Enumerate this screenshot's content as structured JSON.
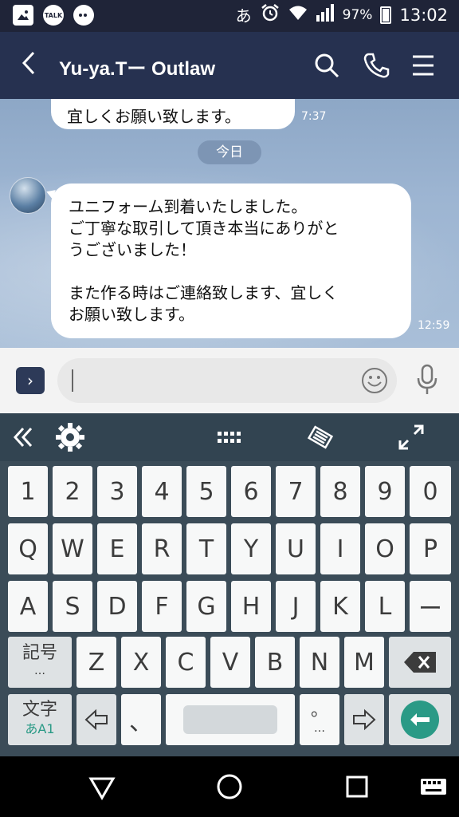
{
  "status_bar": {
    "notification_icons": [
      "image-icon",
      "talk-icon",
      "chat-bubble-icon"
    ],
    "talk_label": "TALK",
    "input_mode": "あ",
    "battery": "97%",
    "time": "13:02"
  },
  "header": {
    "title": "Yu-ya.Tー Outlaw"
  },
  "chat": {
    "previous_message": "宜しくお願い致します。",
    "previous_time": "7:37",
    "date_divider": "今日",
    "message_lines_1": [
      "ユニフォーム到着いたしました。",
      "ご丁寧な取引して頂き本当にありがと",
      "うございました！"
    ],
    "message_lines_2": [
      "また作る時はご連絡致します、宜しく",
      "お願い致します。"
    ],
    "message_time": "12:59"
  },
  "input": {
    "expand_label": "›",
    "placeholder": ""
  },
  "keyboard": {
    "row_numbers": [
      "1",
      "2",
      "3",
      "4",
      "5",
      "6",
      "7",
      "8",
      "9",
      "0"
    ],
    "row_top": [
      "Q",
      "W",
      "E",
      "R",
      "T",
      "Y",
      "U",
      "I",
      "O",
      "P"
    ],
    "row_home": [
      "A",
      "S",
      "D",
      "F",
      "G",
      "H",
      "J",
      "K",
      "L",
      "ー"
    ],
    "row_bottom": [
      "Z",
      "X",
      "C",
      "V",
      "B",
      "N",
      "M"
    ],
    "symbol_key": "記号",
    "symbol_key_dots": "…",
    "mode_key": "文字",
    "mode_key_sub": "あA1",
    "comma_key": "、",
    "period_key": "。",
    "period_key_dots": "…"
  },
  "colors": {
    "header": "#263150",
    "keyboard": "#3b4c58",
    "accent": "#2a9a86"
  }
}
